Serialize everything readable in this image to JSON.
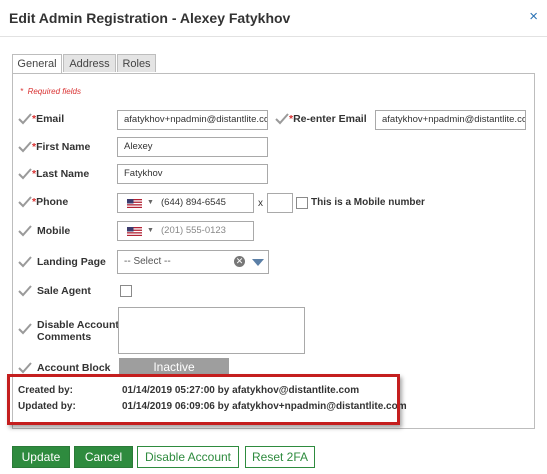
{
  "dialog": {
    "title": "Edit Admin Registration - Alexey Fatykhov",
    "close_icon": "×"
  },
  "tabs": [
    {
      "label": "General"
    },
    {
      "label": "Address"
    },
    {
      "label": "Roles"
    }
  ],
  "required_note": "Required fields",
  "required_mark": "*",
  "fields": {
    "email": {
      "label": "Email",
      "value": "afatykhov+npadmin@distantlite.com"
    },
    "reenter_email": {
      "label": "Re-enter Email",
      "value": "afatykhov+npadmin@distantlite.com"
    },
    "first_name": {
      "label": "First Name",
      "value": "Alexey"
    },
    "last_name": {
      "label": "Last Name",
      "value": "Fatykhov"
    },
    "phone": {
      "label": "Phone",
      "value": "(644) 894-6545",
      "ext_label": "x",
      "ext_value": "",
      "mobile_checkbox_label": "This is a Mobile number"
    },
    "mobile": {
      "label": "Mobile",
      "placeholder": "(201) 555-0123"
    },
    "landing_page": {
      "label": "Landing Page",
      "selected": "-- Select --"
    },
    "sale_agent": {
      "label": "Sale Agent"
    },
    "disable_comments": {
      "label_line1": "Disable Account",
      "label_line2": "Comments",
      "value": ""
    },
    "account_block": {
      "label": "Account Block",
      "status": "Inactive"
    }
  },
  "audit": {
    "created_label": "Created by:",
    "created_value": "01/14/2019 05:27:00 by afatykhov@distantlite.com",
    "updated_label": "Updated by:",
    "updated_value": "01/14/2019 06:09:06 by afatykhov+npadmin@distantlite.com"
  },
  "buttons": {
    "update": "Update",
    "cancel": "Cancel",
    "disable": "Disable Account",
    "reset2fa": "Reset 2FA"
  },
  "colors": {
    "accent_green": "#2e8b3e",
    "required_red": "#d93232",
    "highlight_red": "#c41e1e",
    "close_blue": "#2a72b5"
  }
}
